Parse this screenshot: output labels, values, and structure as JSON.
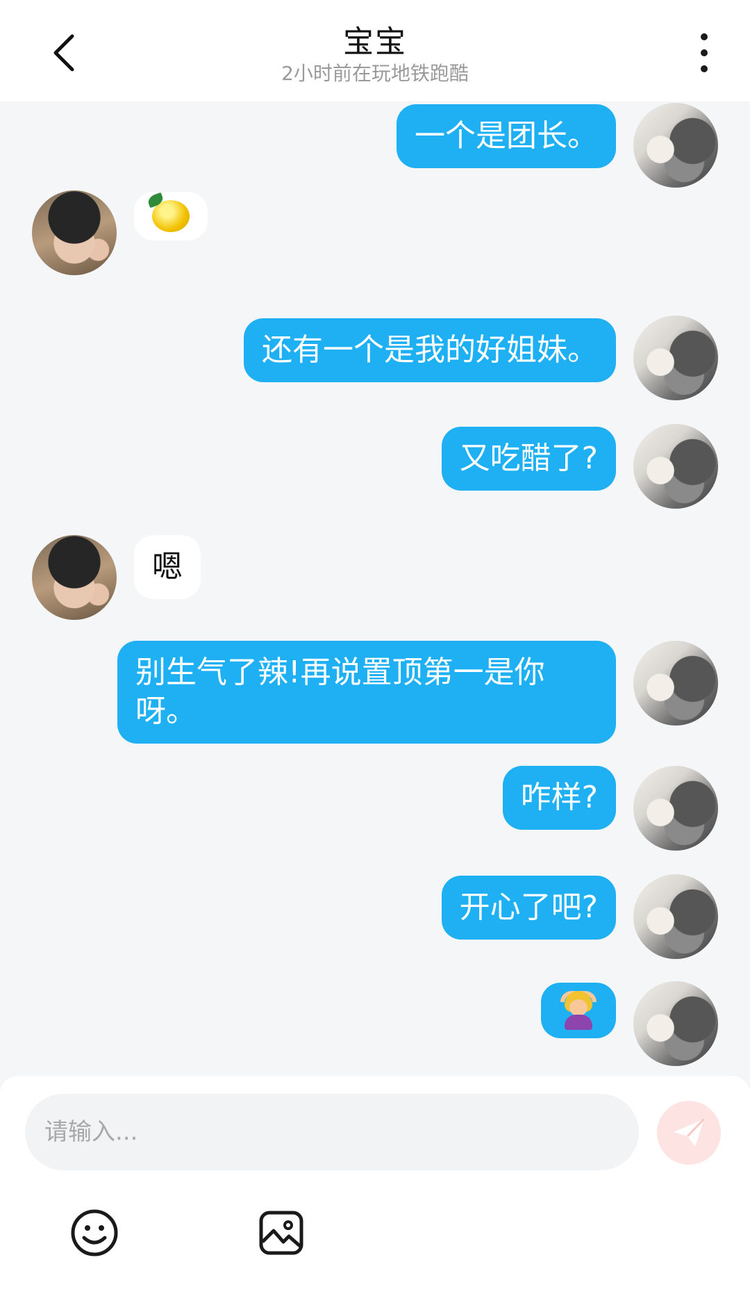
{
  "header": {
    "title": "宝宝",
    "subtitle": "2小时前在玩地铁跑酷"
  },
  "messages": [
    {
      "side": "me",
      "type": "text",
      "text": "一个是团长。"
    },
    {
      "side": "other",
      "type": "emoji",
      "emoji": "lemon"
    },
    {
      "side": "me",
      "type": "text",
      "text": "还有一个是我的好姐妹。"
    },
    {
      "side": "me",
      "type": "text",
      "text": "又吃醋了?"
    },
    {
      "side": "other",
      "type": "text",
      "text": "嗯"
    },
    {
      "side": "me",
      "type": "text",
      "text": "别生气了辣!再说置顶第一是你呀。"
    },
    {
      "side": "me",
      "type": "text",
      "text": "咋样?"
    },
    {
      "side": "me",
      "type": "text",
      "text": "开心了吧?"
    },
    {
      "side": "me",
      "type": "emoji",
      "emoji": "person-gesturing-ok"
    }
  ],
  "composer": {
    "placeholder": "请输入...",
    "send_icon": "send-icon",
    "emoji_icon": "smiley-icon",
    "image_icon": "image-icon"
  },
  "colors": {
    "my_bubble": "#1fb0f3",
    "other_bubble": "#ffffff",
    "background": "#f4f6f7",
    "send_button": "#fde3e1"
  }
}
